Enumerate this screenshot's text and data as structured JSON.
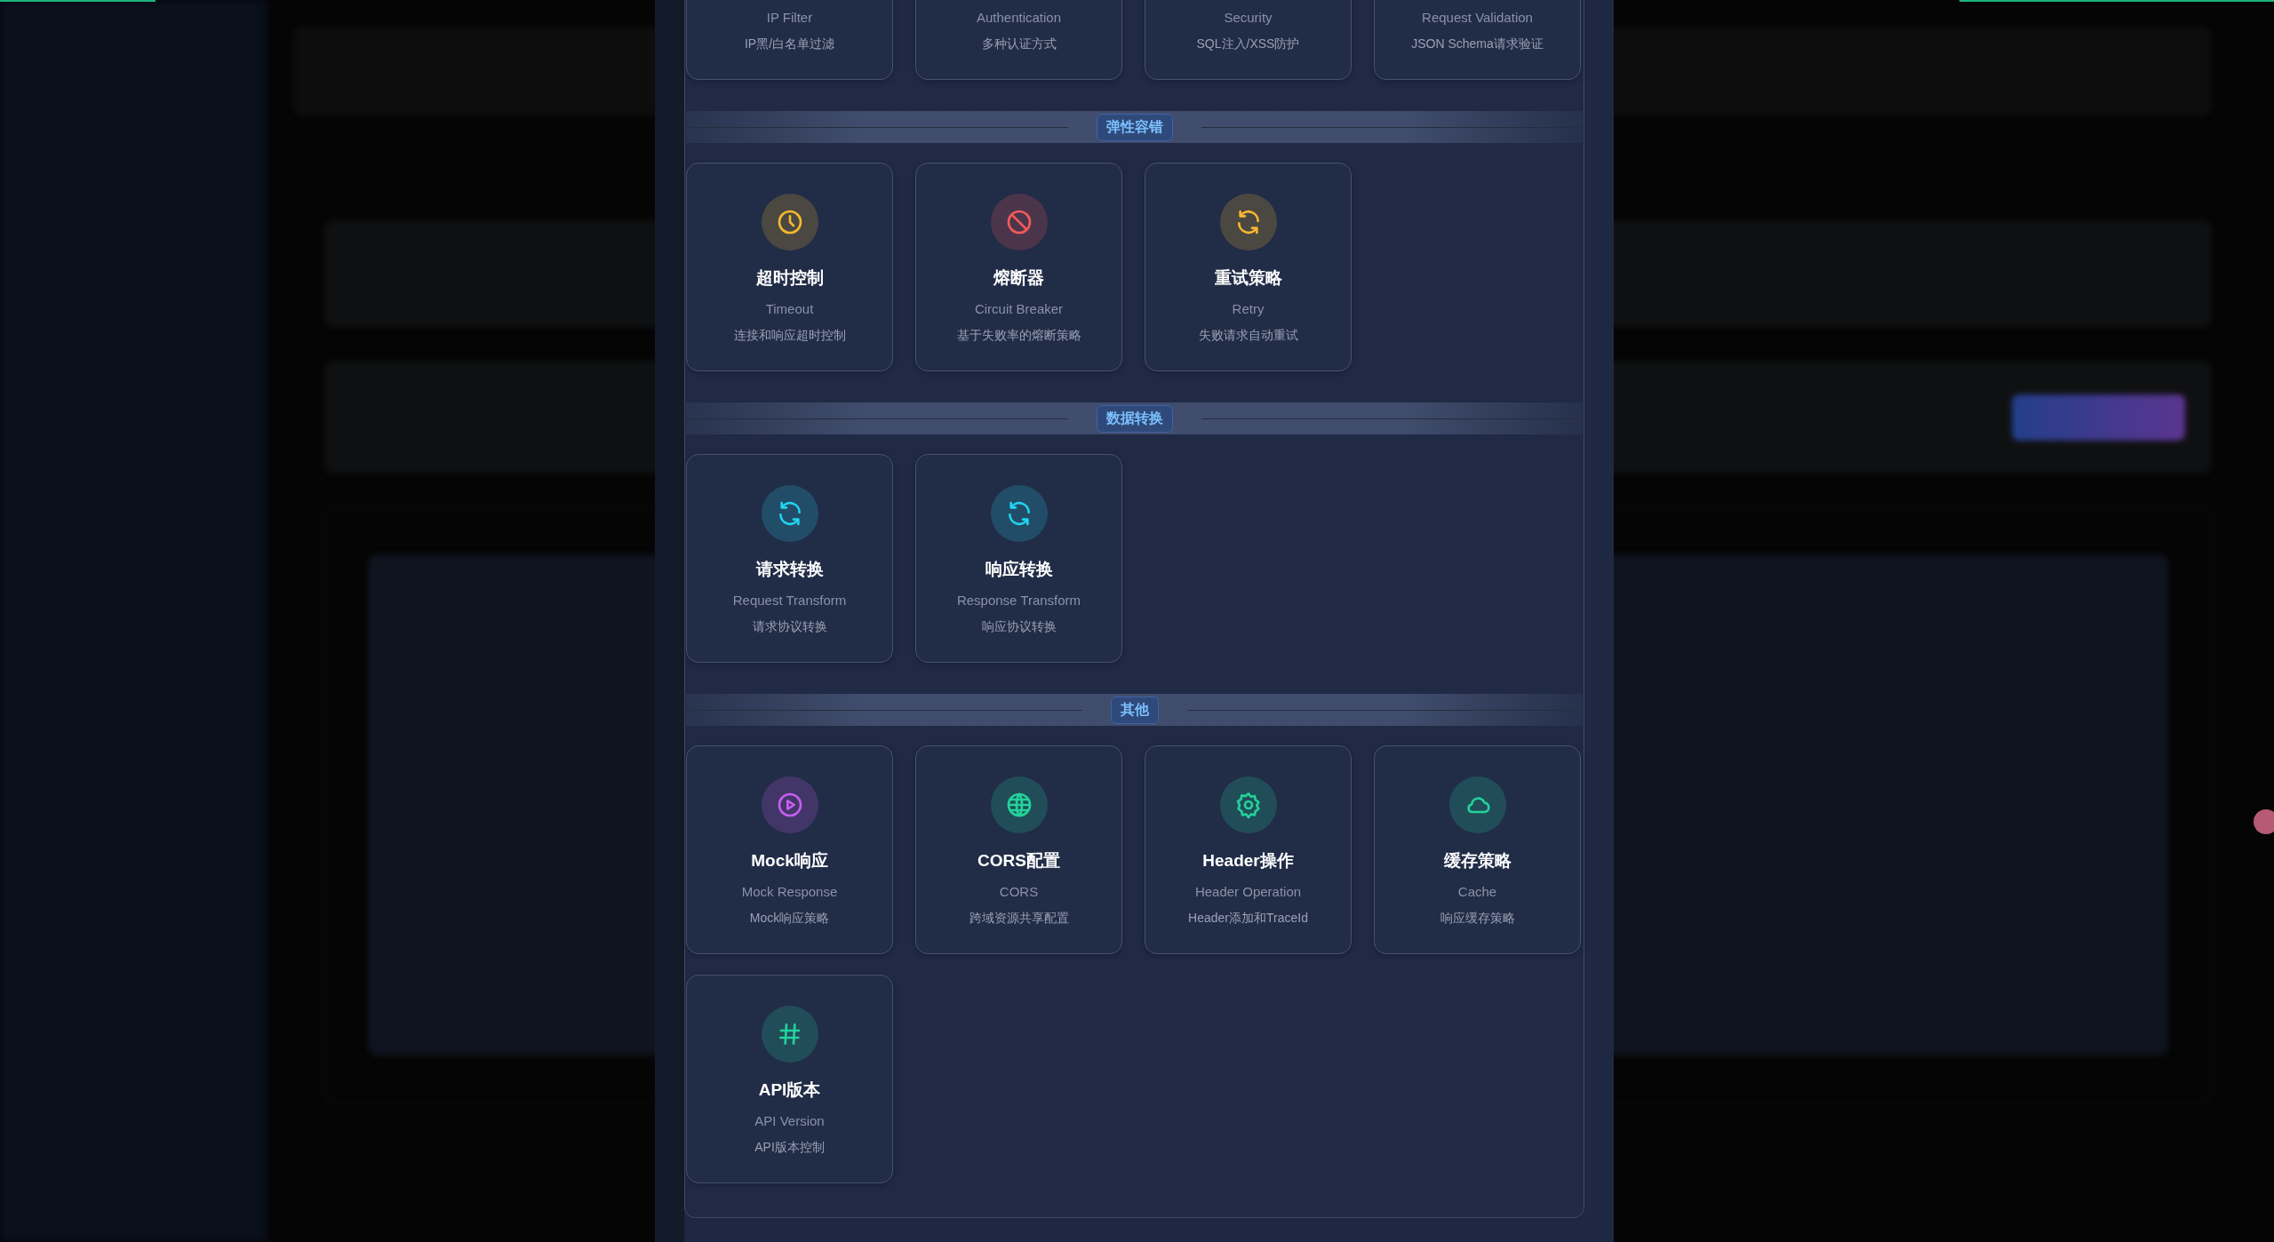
{
  "strategy_groups": [
    {
      "items": [
        {
          "name_en": "IP Filter",
          "description": "IP黑/白名单过滤"
        },
        {
          "name_en": "Authentication",
          "description": "多种认证方式"
        },
        {
          "name_en": "Security",
          "description": "SQL注入/XSS防护"
        },
        {
          "name_en": "Request Validation",
          "description": "JSON Schema请求验证"
        }
      ]
    },
    {
      "label": "弹性容错",
      "items": [
        {
          "kind": "clock",
          "color": "#f5b82e",
          "title": "超时控制",
          "name_en": "Timeout",
          "description": "连接和响应超时控制"
        },
        {
          "kind": "ban",
          "color": "#f25a5a",
          "title": "熔断器",
          "name_en": "Circuit Breaker",
          "description": "基于失败率的熔断策略"
        },
        {
          "kind": "refresh",
          "color": "#f5b82e",
          "title": "重试策略",
          "name_en": "Retry",
          "description": "失败请求自动重试"
        }
      ]
    },
    {
      "label": "数据转换",
      "items": [
        {
          "kind": "refresh",
          "color": "#22d3ee",
          "title": "请求转换",
          "name_en": "Request Transform",
          "description": "请求协议转换"
        },
        {
          "kind": "refresh",
          "color": "#22d3ee",
          "title": "响应转换",
          "name_en": "Response Transform",
          "description": "响应协议转换"
        }
      ]
    },
    {
      "label": "其他",
      "items": [
        {
          "kind": "play",
          "color": "#c65ef0",
          "title": "Mock响应",
          "name_en": "Mock Response",
          "description": "Mock响应策略"
        },
        {
          "kind": "globe",
          "color": "#22d39a",
          "title": "CORS配置",
          "name_en": "CORS",
          "description": "跨域资源共享配置"
        },
        {
          "kind": "gear",
          "color": "#22d39a",
          "title": "Header操作",
          "name_en": "Header Operation",
          "description": "Header添加和TraceId"
        },
        {
          "kind": "cloud",
          "color": "#22d39a",
          "title": "缓存策略",
          "name_en": "Cache",
          "description": "响应缓存策略"
        },
        {
          "kind": "hash",
          "color": "#22d39a",
          "title": "API版本",
          "name_en": "API Version",
          "description": "API版本控制"
        }
      ]
    }
  ]
}
